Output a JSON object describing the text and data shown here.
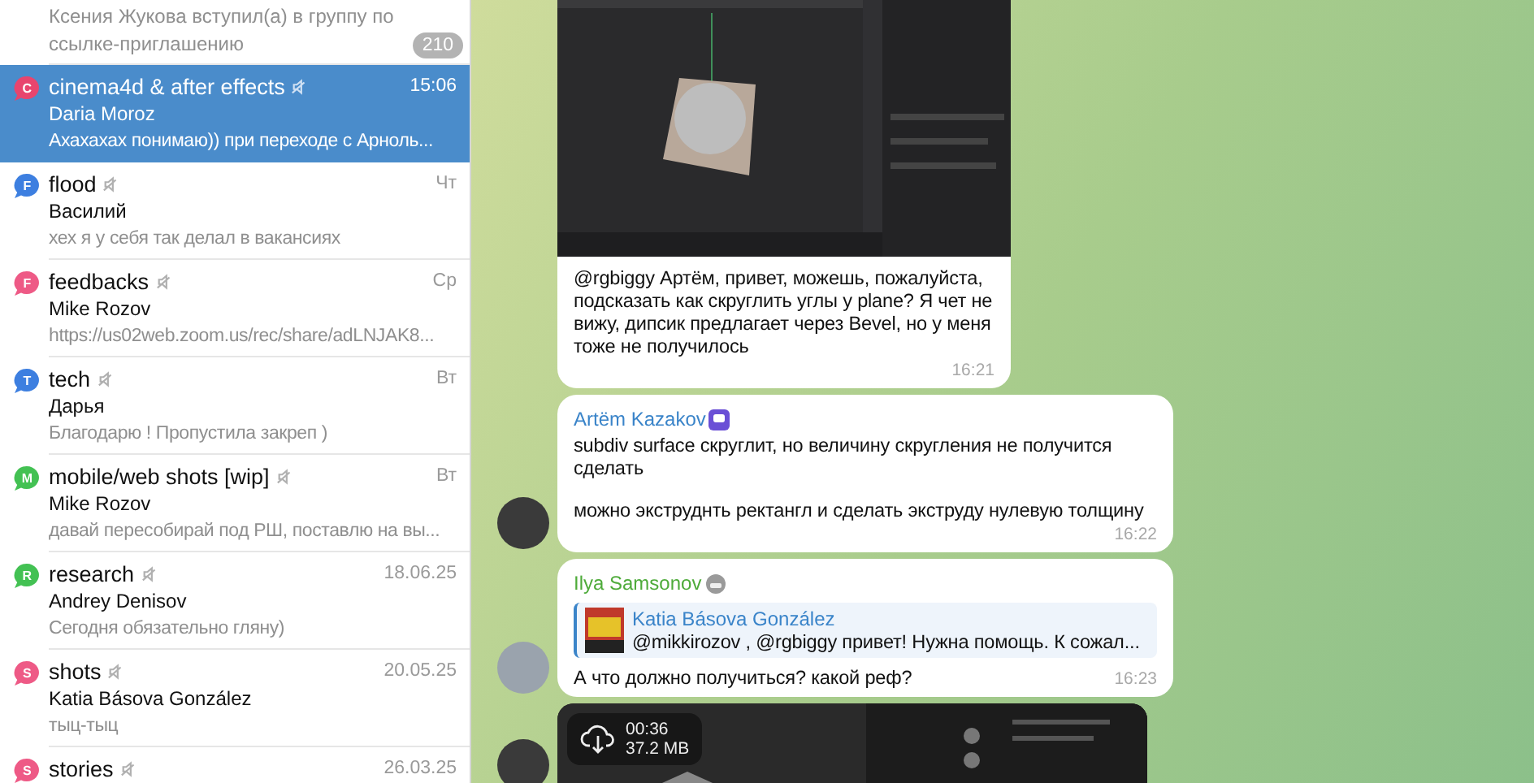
{
  "chat_list": {
    "items": [
      {
        "kind": "join",
        "preview": "Ксения Жукова вступил(а) в группу по ссылке-приглашению",
        "badge": "210",
        "selected": false
      },
      {
        "kind": "chat",
        "title": "cinema4d & after effects",
        "muted": true,
        "time": "15:06",
        "sender": "Daria Moroz",
        "preview": "Ахахахах понимаю)) при переходе с Арноль...",
        "avatar_letter": "C",
        "color": "#e8456e",
        "selected": true
      },
      {
        "kind": "chat",
        "title": "flood",
        "muted": true,
        "time": "Чт",
        "sender": "Василий",
        "preview": "хех я у себя так делал в вакансиях",
        "avatar_letter": "F",
        "color": "#3d7fe0",
        "selected": false
      },
      {
        "kind": "chat",
        "title": "feedbacks",
        "muted": true,
        "time": "Ср",
        "sender": "Mike Rozov",
        "preview": "https://us02web.zoom.us/rec/share/adLNJAK8...",
        "avatar_letter": "F",
        "color": "#ee5a86",
        "selected": false
      },
      {
        "kind": "chat",
        "title": "tech",
        "muted": true,
        "time": "Вт",
        "sender": "Дарья",
        "preview": "Благодарю ! Пропустила закреп )",
        "avatar_letter": "T",
        "color": "#3d7fe0",
        "selected": false
      },
      {
        "kind": "chat",
        "title": "mobile/web shots [wip]",
        "muted": true,
        "time": "Вт",
        "sender": "Mike Rozov",
        "preview": "давай пересобирай под РШ, поставлю на вы...",
        "avatar_letter": "M",
        "color": "#43c153",
        "selected": false
      },
      {
        "kind": "chat",
        "title": "research",
        "muted": true,
        "time": "18.06.25",
        "sender": "Andrey Denisov",
        "preview": "Сегодня обязательно гляну)",
        "avatar_letter": "R",
        "color": "#43c153",
        "selected": false
      },
      {
        "kind": "chat",
        "title": "shots",
        "muted": true,
        "time": "20.05.25",
        "sender": "Katia Básova González",
        "preview": "тыц-тыц",
        "avatar_letter": "S",
        "color": "#ee5a86",
        "selected": false
      },
      {
        "kind": "chat",
        "title": "stories",
        "muted": true,
        "time": "26.03.25",
        "avatar_letter": "S",
        "color": "#ee5a86",
        "selected": false
      }
    ]
  },
  "chat": {
    "messages": [
      {
        "text": [
          "@rgbiggy Артём, привет, можешь, пожалуйста, подсказать как скруглить углы у plane? Я чет не вижу, дипсик предлагает через Bevel, но у меня тоже не получилось"
        ],
        "time": "16:21"
      },
      {
        "kind": "text",
        "sender": "Artëm Kazakov",
        "color": "#3a84c9",
        "text": [
          "subdiv surface скруглит, но величину скругления не получится сделать",
          "можно экструднть ректангл и сделать экструду нулевую толщину"
        ],
        "time": "16:22"
      },
      {
        "kind": "reply",
        "sender": "Ilya Samsonov",
        "color": "#4eab3a",
        "quote_author": "Katia Básova González",
        "quote_text": "@mikkirozov , @rgbiggy привет! Нужна помощь. К сожал...",
        "text": [
          "А что должно получиться? какой реф?"
        ],
        "time": "16:23"
      },
      {
        "kind": "video",
        "duration": "00:36",
        "size": "37.2 MB"
      }
    ]
  }
}
